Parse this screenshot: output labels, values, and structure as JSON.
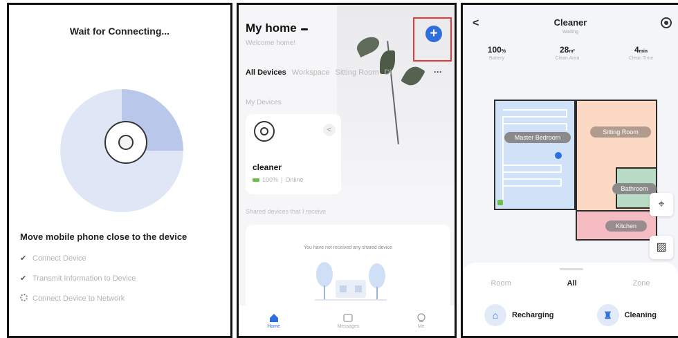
{
  "connecting_screen": {
    "title": "Wait for Connecting...",
    "instruction": "Move mobile phone close to the device",
    "steps": [
      {
        "label": "Connect Device",
        "state": "done"
      },
      {
        "label": "Transmit Information to Device",
        "state": "done"
      },
      {
        "label": "Connect Device to Network",
        "state": "in-progress"
      }
    ],
    "colors": {
      "progress": "#b9c8ea",
      "track": "#dfe7f6"
    },
    "progress_fraction": 0.25
  },
  "home_screen": {
    "home_name": "My home",
    "welcome": "Welcome home!",
    "add_button_icon": "plus-icon",
    "tabs": [
      "All Devices",
      "Workspace",
      "Sitting Room",
      "Di"
    ],
    "active_tab": "All Devices",
    "my_devices_label": "My Devices",
    "device": {
      "name": "cleaner",
      "battery": "100%",
      "status": "Online"
    },
    "shared_label": "Shared devices that I receive",
    "empty_message": "You have not received any shared device",
    "nav": [
      {
        "label": "Home",
        "icon": "home-icon",
        "active": true
      },
      {
        "label": "Messages",
        "icon": "message-icon",
        "active": false
      },
      {
        "label": "Me",
        "icon": "user-icon",
        "active": false
      }
    ],
    "colors": {
      "accent": "#2f6fdc",
      "highlight": "#e53935"
    }
  },
  "cleaner_screen": {
    "title": "Cleaner",
    "status": "Waiting",
    "stats": [
      {
        "value": "100",
        "unit": "%",
        "label": "Battery"
      },
      {
        "value": "28",
        "unit": "m²",
        "label": "Clean Area"
      },
      {
        "value": "4",
        "unit": "min",
        "label": "Clean Time"
      }
    ],
    "rooms": [
      "Master Bedroom",
      "Sitting Room",
      "Bathroom",
      "Kitchen"
    ],
    "modes": [
      "Room",
      "All",
      "Zone"
    ],
    "active_mode": "All",
    "actions": [
      {
        "label": "Recharging",
        "icon": "recharge-icon"
      },
      {
        "label": "Cleaning",
        "icon": "cleaning-icon"
      }
    ],
    "colors": {
      "bedroom": "#cfe2f7",
      "sitting": "#fbd9c4",
      "bathroom": "#b8dcc6",
      "kitchen": "#f6bcc3"
    }
  }
}
